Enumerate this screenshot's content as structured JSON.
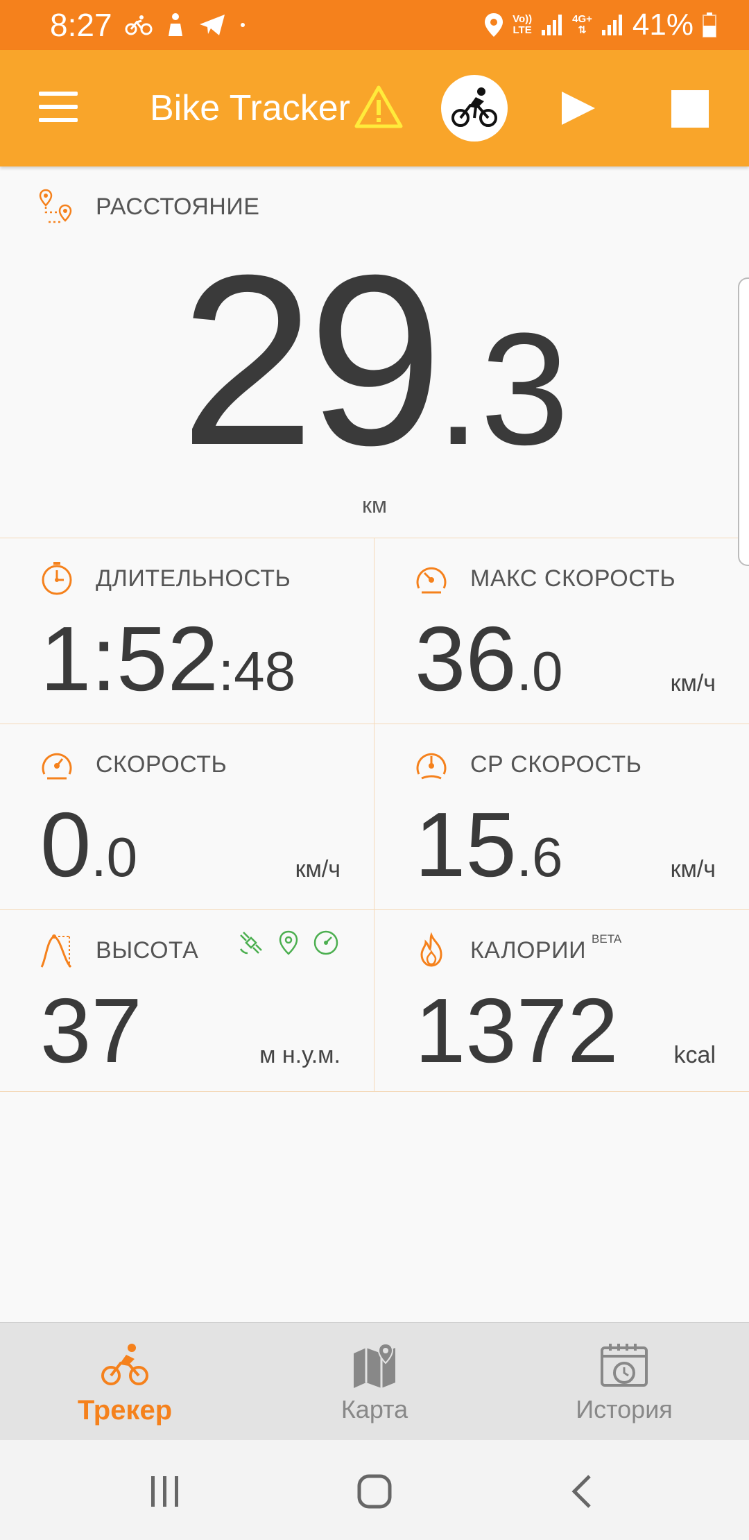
{
  "status_bar": {
    "time": "8:27",
    "volte_top": "Vo))",
    "volte_bottom": "LTE",
    "network": "4G+",
    "battery": "41%"
  },
  "app_bar": {
    "title": "Bike Tracker"
  },
  "distance": {
    "label": "РАССТОЯНИЕ",
    "value_int": "29",
    "value_frac": ".3",
    "unit": "км"
  },
  "stats": {
    "duration": {
      "label": "ДЛИТЕЛЬНОСТЬ",
      "main": "1:52",
      "small": ":48"
    },
    "max_speed": {
      "label": "МАКС СКОРОСТЬ",
      "main": "36",
      "small": ".0",
      "unit": "км/ч"
    },
    "speed": {
      "label": "СКОРОСТЬ",
      "main": "0",
      "small": ".0",
      "unit": "км/ч"
    },
    "avg_speed": {
      "label": "СР СКОРОСТЬ",
      "main": "15",
      "small": ".6",
      "unit": "км/ч"
    },
    "altitude": {
      "label": "ВЫСОТА",
      "main": "37",
      "unit": "м н.у.м."
    },
    "calories": {
      "label": "КАЛОРИИ",
      "badge": "BETA",
      "main": "1372",
      "unit": "kcal"
    }
  },
  "bottom_nav": {
    "items": [
      {
        "label": "Трекер",
        "icon": "bike-icon",
        "active": true
      },
      {
        "label": "Карта",
        "icon": "map-icon",
        "active": false
      },
      {
        "label": "История",
        "icon": "history-icon",
        "active": false
      }
    ]
  },
  "colors": {
    "status_bar": "#f5811c",
    "app_bar": "#f9a52a",
    "accent": "#f5811c",
    "gps_green": "#4caf50",
    "warning": "#ffeb3b"
  }
}
